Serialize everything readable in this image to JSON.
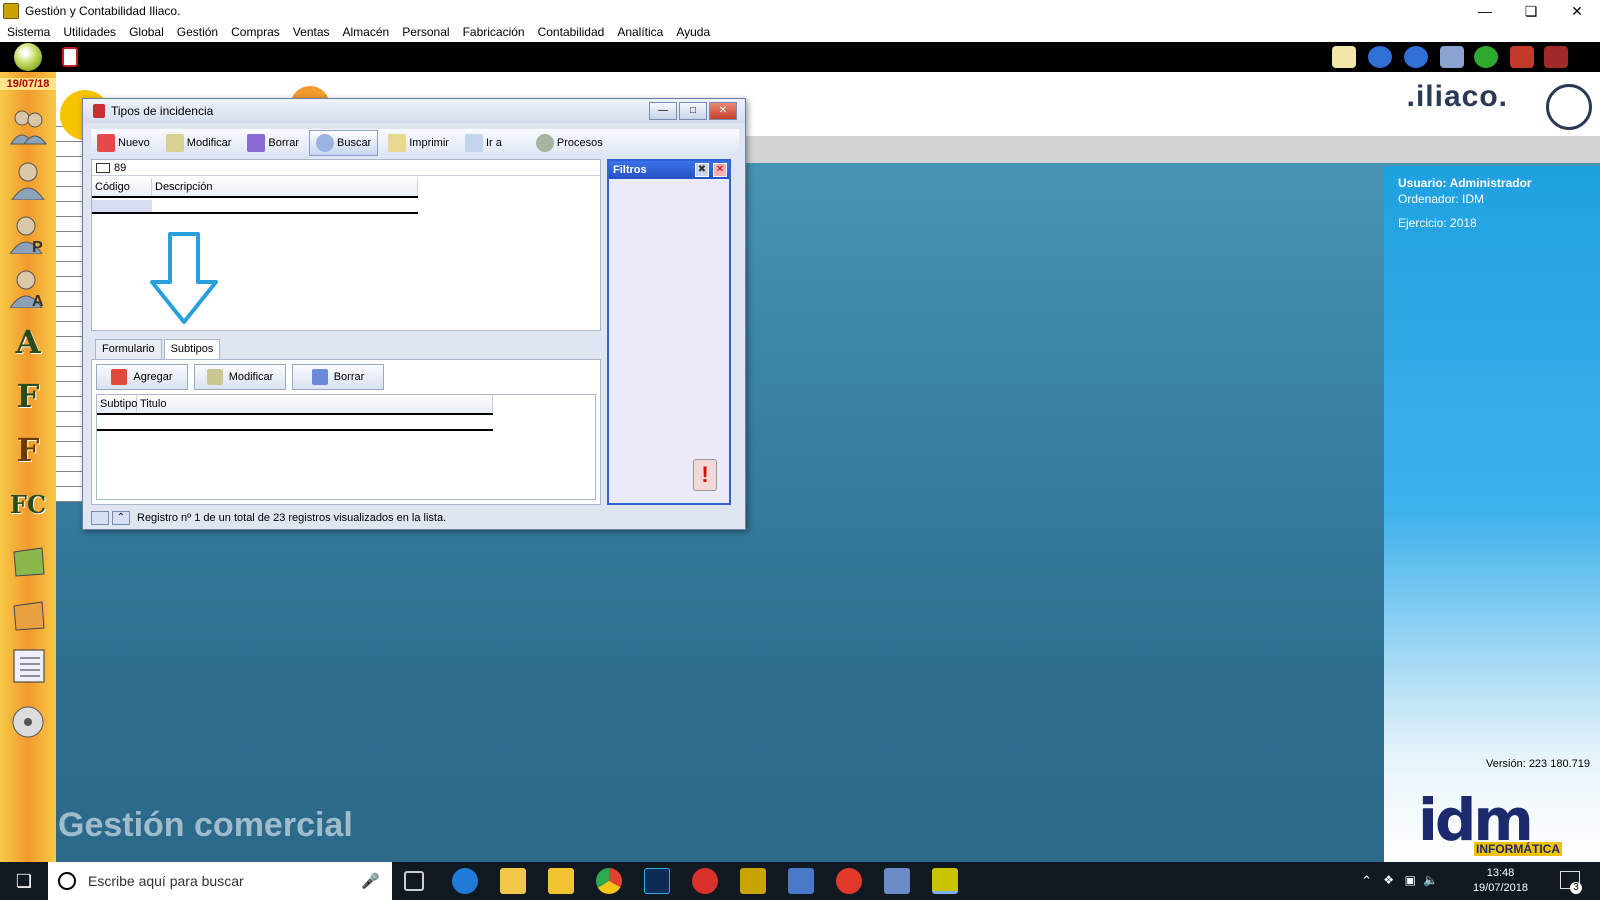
{
  "window": {
    "title": "Gestión y Contabilidad Iliaco."
  },
  "menu": [
    "Sistema",
    "Utilidades",
    "Global",
    "Gestión",
    "Compras",
    "Ventas",
    "Almacén",
    "Personal",
    "Fabricación",
    "Contabilidad",
    "Analítica",
    "Ayuda"
  ],
  "sidebar": {
    "date": "19/07/18"
  },
  "brand": {
    "logo_text": ".iliaco.",
    "module_label": "Gestión comercial"
  },
  "info": {
    "usuario": "Usuario: Administrador",
    "ordenador": "Ordenador: IDM",
    "ejercicio": "Ejercicio: 2018",
    "version": "Versión: 223 180.719",
    "company_logo": "idm",
    "company_sub": "INFORMÁTICA"
  },
  "dialog": {
    "title": "Tipos de incidencia",
    "toolbar": {
      "nuevo": "Nuevo",
      "modificar": "Modificar",
      "borrar": "Borrar",
      "buscar": "Buscar",
      "imprimir": "Imprimir",
      "ir_a": "Ir a",
      "procesos": "Procesos"
    },
    "list": {
      "count": "89",
      "columns": [
        "Código",
        "Descripción"
      ]
    },
    "filters": {
      "title": "Filtros"
    },
    "tabs": [
      "Formulario",
      "Subtipos"
    ],
    "active_tab": "Subtipos",
    "subtipos": {
      "agregar": "Agregar",
      "modificar": "Modificar",
      "borrar": "Borrar",
      "columns": [
        "Subtipo",
        "Titulo"
      ]
    },
    "status": "Registro nº 1 de un total de 23 registros visualizados en la lista."
  },
  "taskbar": {
    "search_placeholder": "Escribe aquí para buscar",
    "time": "13:48",
    "date": "19/07/2018",
    "notifications": "3"
  },
  "colors": {
    "accent_blue": "#1fa1e0",
    "sidebar_orange": "#f29a2e",
    "desktop_blue": "#3b86a7"
  }
}
